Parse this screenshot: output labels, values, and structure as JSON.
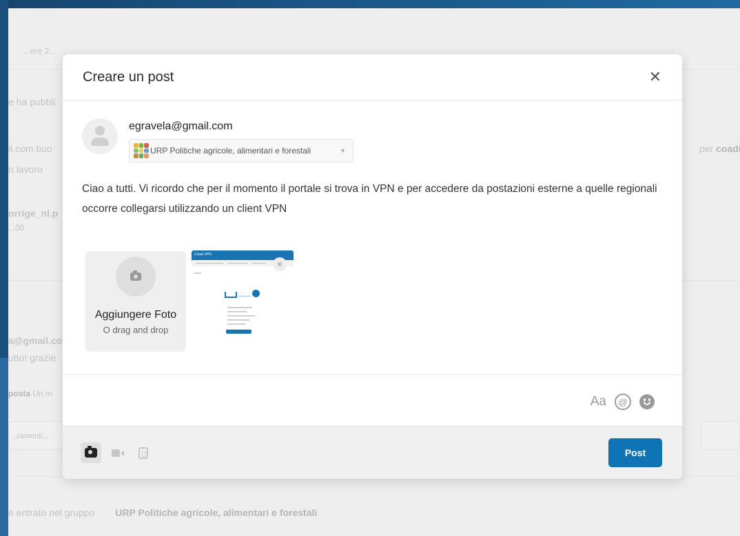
{
  "background_feed": {
    "search_hint": "...ere 2...",
    "snippet_1": "e ha pubbli",
    "snippet_2": "il.com buo",
    "snippet_3": "n lavoro",
    "snippet_4": "orrige_nl.p",
    "snippet_5": "...00",
    "snippet_right_prefix": "per",
    "snippet_right_bold": "coadiuv",
    "snippet_6": "a@gmail.co",
    "snippet_7": "utto! grazie",
    "snippet_8_label": "posta",
    "snippet_8_rest": "Un m",
    "snippet_9": "...ramenti...",
    "joined_text": "è entrato nel gruppo",
    "joined_group": "URP Politiche agricole, alimentari e forestali"
  },
  "modal": {
    "title": "Creare un post",
    "close_icon": "close-icon",
    "author": {
      "email": "egravela@gmail.com",
      "group": "URP Politiche agricole, alimentari e forestali"
    },
    "post_text": "Ciao a tutti. Vi ricordo che per il momento il portale si trova in VPN e per accedere da postazioni esterne a quelle regionali occorre collegarsi utilizzando un client VPN",
    "add_photo": {
      "label": "Aggiungere Foto",
      "sub": "O drag and drop"
    },
    "thumbnail": {
      "header_text": "Cloud VPN"
    },
    "format_tools": {
      "text_style": "Aa",
      "mention": "@"
    },
    "footer": {
      "post_button": "Post"
    }
  },
  "colors": {
    "accent": "#0f74b6",
    "frame_blue": "#1e5a88"
  }
}
